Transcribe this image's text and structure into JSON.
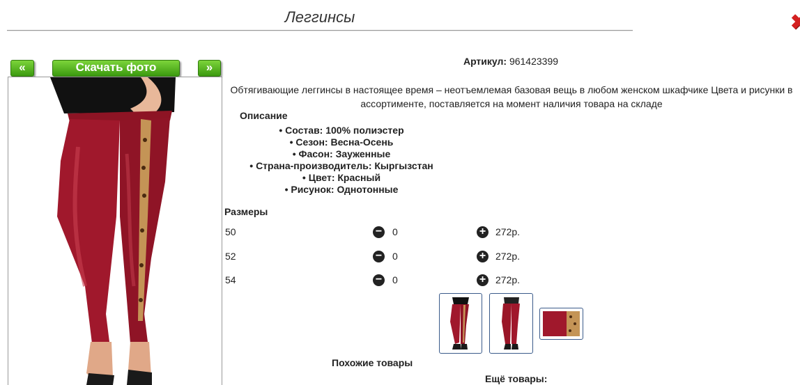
{
  "header": {
    "title": "Леггинсы"
  },
  "icons": {
    "close": "close-icon",
    "minus": "minus-circle-icon",
    "plus": "plus-circle-icon"
  },
  "gallery": {
    "prev_label": "«",
    "download_label": "Скачать фото",
    "next_label": "»"
  },
  "product": {
    "sku_label": "Артикул:",
    "sku_value": "961423399",
    "description": "Обтягивающие леггинсы в настоящее время – неотъемлемая базовая вещь в любом женском шкафчике Цвета и рисунки в ассортименте, поставляется на момент наличия товара на складе",
    "details_title": "Описание",
    "details": [
      "Состав: 100% полиэстер",
      "Сезон: Весна-Осень",
      "Фасон: Зауженные",
      "Страна-производитель: Кыргызстан",
      "Цвет: Красный",
      "Рисунок: Однотонные"
    ]
  },
  "sizes": {
    "title": "Размеры",
    "rows": [
      {
        "size": "50",
        "qty": "0",
        "price": "272р."
      },
      {
        "size": "52",
        "qty": "0",
        "price": "272р."
      },
      {
        "size": "54",
        "qty": "0",
        "price": "272р."
      }
    ]
  },
  "colors": {
    "accent_green": "#4caf1c",
    "leggings": "#a0182c",
    "close_red": "#d42020",
    "thumb_border": "#3a5a8a"
  },
  "footer": {
    "similar_label": "Похожие товары",
    "more_label": "Ещё товары:"
  }
}
